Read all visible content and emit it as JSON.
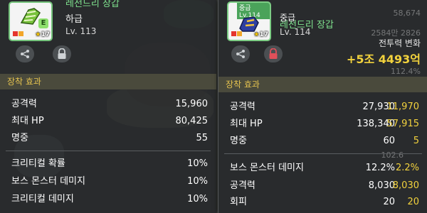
{
  "left_panel": {
    "item_name": "레전드리 장갑",
    "grade": "하급",
    "level": "Lv. 113",
    "icon_level": "17",
    "grade_badge": "E",
    "section_title": "장착 효과",
    "stats": [
      {
        "label": "공격력",
        "value": "15,960"
      },
      {
        "label": "최대 HP",
        "value": "80,425"
      },
      {
        "label": "명중",
        "value": "55"
      }
    ],
    "stats2": [
      {
        "label": "크리티컬 확률",
        "value": "10%"
      },
      {
        "label": "보스 몬스터 데미지",
        "value": "10%"
      },
      {
        "label": "크리티컬 데미지",
        "value": "10%"
      }
    ]
  },
  "right_panel": {
    "badge": "중급",
    "badge_level": "Lv.114",
    "item_name": "레전드리 장갑",
    "grade": "중급",
    "level": "Lv. 114",
    "icon_level": "17",
    "power_label": "전투력 변화",
    "power_value": "+5조 4493억",
    "section_title": "장착 효과",
    "stats": [
      {
        "label": "공격력",
        "value": "27,930",
        "diff": "11,970"
      },
      {
        "label": "최대 HP",
        "value": "138,340",
        "diff": "57,915"
      },
      {
        "label": "명중",
        "value": "60",
        "diff": "5"
      },
      {
        "label": "보스 몬스터 데미지",
        "value": "12.2%",
        "diff": "2.2%"
      },
      {
        "label": "공격력",
        "value": "8,030",
        "diff": "8,030"
      },
      {
        "label": "회피",
        "value": "20",
        "diff": "20"
      }
    ],
    "ghost_texts": [
      "58,674",
      "2584만 2826",
      "112.4%",
      "102.6"
    ]
  },
  "colors": {
    "accent_green": "#7fe28e",
    "diff_yellow": "#f2d23d",
    "section_text": "#e5c34f"
  }
}
